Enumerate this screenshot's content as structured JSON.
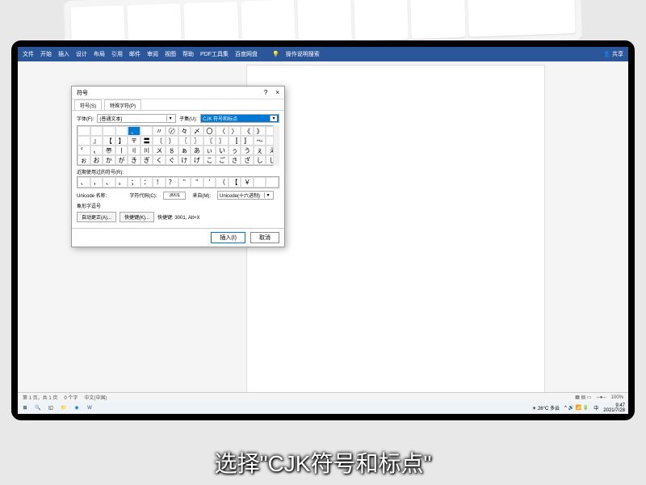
{
  "ribbon": {
    "tabs": [
      "文件",
      "开始",
      "插入",
      "设计",
      "布局",
      "引用",
      "邮件",
      "审阅",
      "视图",
      "帮助",
      "PDF工具集",
      "百度网盘"
    ],
    "search_icon": "💡",
    "search_text": "操作说明搜索",
    "share": "共享"
  },
  "dialog": {
    "title": "符号",
    "help": "?",
    "close": "×",
    "tabs": [
      "符号(S)",
      "特殊字符(P)"
    ],
    "font_label": "字体(F):",
    "font_value": "(普通文本)",
    "subset_label": "子集(U):",
    "subset_value": "CJK 符号和标点",
    "symbols_r1": [
      "",
      "",
      "",
      "",
      "、",
      "",
      "〃",
      "〄",
      "々",
      "〆",
      "〇",
      "〈",
      "〉",
      "《",
      "》",
      ""
    ],
    "symbols_r2": [
      "",
      "』",
      "【",
      "】",
      "〒",
      "〓",
      "〔",
      "〕",
      "〖",
      "〗",
      "〘",
      "〙",
      "〚",
      "〛",
      "〜",
      "〝"
    ],
    "symbols_r3": [
      "〞",
      "〟",
      "〠",
      "〡",
      "〢",
      "〣",
      "〤",
      "〥",
      "ぁ",
      "あ",
      "ぃ",
      "い",
      "ぅ",
      "う",
      "ぇ",
      "え"
    ],
    "symbols_r4": [
      "ぉ",
      "お",
      "か",
      "が",
      "き",
      "ぎ",
      "く",
      "ぐ",
      "け",
      "げ",
      "こ",
      "ご",
      "さ",
      "ざ",
      "し",
      "じ"
    ],
    "selected_index": 4,
    "recent_label": "近期使用过的符号(R):",
    "recent": [
      "、",
      "，",
      "、",
      "。",
      "；",
      "：",
      "！",
      "？",
      "\"",
      "\"",
      "'",
      "（",
      "【",
      "￥"
    ],
    "unicode_label": "Unicode 名称:",
    "char_name": "象形字逗号",
    "code_label": "字符代码(C):",
    "code_value": "3001",
    "from_label": "来自(M):",
    "from_value": "Unicode(十六进制)",
    "autocorrect": "自动更正(A)...",
    "shortcut": "快捷键(K)...",
    "shortcut_text": "快捷键: 3001, Alt+X",
    "insert": "插入(I)",
    "cancel": "取消"
  },
  "statusbar": {
    "page": "第 1 页，共 1 页",
    "words": "0 个字",
    "lang": "中文(中国)",
    "zoom": "100%"
  },
  "taskbar": {
    "weather": "26°C 多云",
    "time": "9:47",
    "date": "2021/7/28"
  },
  "caption": "选择\"CJK符号和标点\""
}
